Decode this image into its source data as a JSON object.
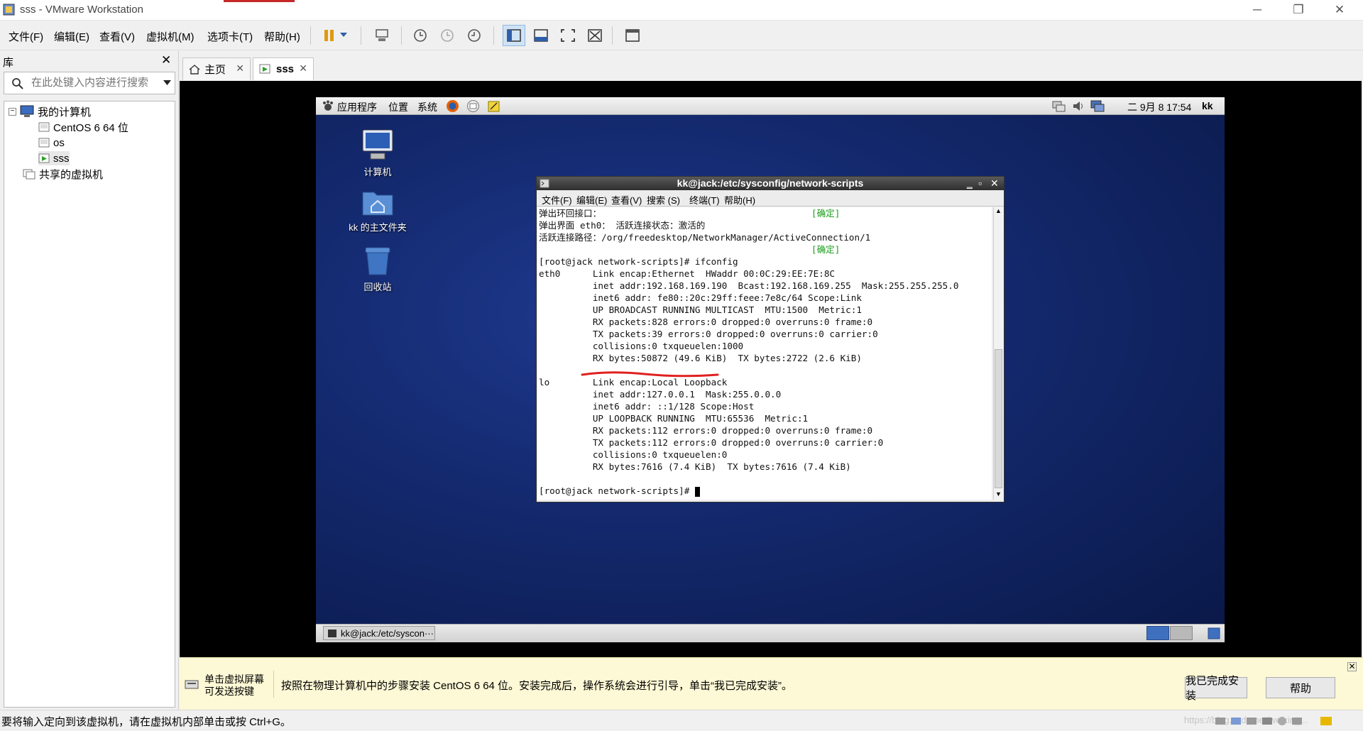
{
  "window": {
    "title": "sss - VMware Workstation",
    "controls": {
      "minimize": "─",
      "restore": "❐",
      "close": "✕"
    }
  },
  "menubar": {
    "items": [
      "文件(F)",
      "编辑(E)",
      "查看(V)",
      "虚拟机(M)",
      "选项卡(T)",
      "帮助(H)"
    ]
  },
  "library": {
    "header": "库",
    "search_placeholder": "在此处键入内容进行搜索",
    "tree": {
      "root": "我的计算机",
      "vms": [
        "CentOS 6 64 位",
        "os",
        "sss"
      ],
      "shared": "共享的虚拟机"
    }
  },
  "tabs": [
    {
      "label": "主页",
      "active": false
    },
    {
      "label": "sss",
      "active": true
    }
  ],
  "guest": {
    "panel": {
      "apps": "应用程序",
      "places": "位置",
      "system": "系统",
      "clock": "二 9月  8 17:54",
      "user": "kk"
    },
    "desktop_icons": [
      "计算机",
      "kk 的主文件夹",
      "回收站"
    ],
    "taskbar_item": "kk@jack:/etc/syscon···",
    "terminal": {
      "title": "kk@jack:/etc/sysconfig/network-scripts",
      "menu": [
        "文件(F)",
        "编辑(E)",
        "查看(V)",
        "搜索 (S)",
        "终端(T)",
        "帮助(H)"
      ],
      "lines": [
        {
          "text": "弹出环回接口：",
          "ok": "[确定]"
        },
        {
          "text": "弹出界面 eth0： 活跃连接状态：激活的",
          "ok": ""
        },
        {
          "text": "活跃连接路径：/org/freedesktop/NetworkManager/ActiveConnection/1",
          "ok": ""
        },
        {
          "text": "",
          "ok": "[确定]"
        },
        {
          "text": "[root@jack network-scripts]# ifconfig",
          "ok": ""
        },
        {
          "text": "eth0      Link encap:Ethernet  HWaddr 00:0C:29:EE:7E:8C",
          "ok": ""
        },
        {
          "text": "          inet addr:192.168.169.190  Bcast:192.168.169.255  Mask:255.255.255.0",
          "ok": ""
        },
        {
          "text": "          inet6 addr: fe80::20c:29ff:feee:7e8c/64 Scope:Link",
          "ok": ""
        },
        {
          "text": "          UP BROADCAST RUNNING MULTICAST  MTU:1500  Metric:1",
          "ok": ""
        },
        {
          "text": "          RX packets:828 errors:0 dropped:0 overruns:0 frame:0",
          "ok": ""
        },
        {
          "text": "          TX packets:39 errors:0 dropped:0 overruns:0 carrier:0",
          "ok": ""
        },
        {
          "text": "          collisions:0 txqueuelen:1000",
          "ok": ""
        },
        {
          "text": "          RX bytes:50872 (49.6 KiB)  TX bytes:2722 (2.6 KiB)",
          "ok": ""
        },
        {
          "text": "",
          "ok": ""
        },
        {
          "text": "lo        Link encap:Local Loopback",
          "ok": ""
        },
        {
          "text": "          inet addr:127.0.0.1  Mask:255.0.0.0",
          "ok": ""
        },
        {
          "text": "          inet6 addr: ::1/128 Scope:Host",
          "ok": ""
        },
        {
          "text": "          UP LOOPBACK RUNNING  MTU:65536  Metric:1",
          "ok": ""
        },
        {
          "text": "          RX packets:112 errors:0 dropped:0 overruns:0 frame:0",
          "ok": ""
        },
        {
          "text": "          TX packets:112 errors:0 dropped:0 overruns:0 carrier:0",
          "ok": ""
        },
        {
          "text": "          collisions:0 txqueuelen:0",
          "ok": ""
        },
        {
          "text": "          RX bytes:7616 (7.4 KiB)  TX bytes:7616 (7.4 KiB)",
          "ok": ""
        },
        {
          "text": "",
          "ok": ""
        },
        {
          "text": "[root@jack network-scripts]# ",
          "ok": ""
        }
      ]
    }
  },
  "hint": {
    "icon_text": "单击虚拟屏幕\n可发送按键",
    "message": "按照在物理计算机中的步骤安装 CentOS 6 64 位。安装完成后，操作系统会进行引导，单击“我已完成安装”。",
    "done_button": "我已完成安装",
    "help_button": "帮助"
  },
  "status": {
    "text": "要将输入定向到该虚拟机，请在虚拟机内部单击或按 Ctrl+G。",
    "watermark": "https://blog.csdn.net/weixin_..."
  }
}
